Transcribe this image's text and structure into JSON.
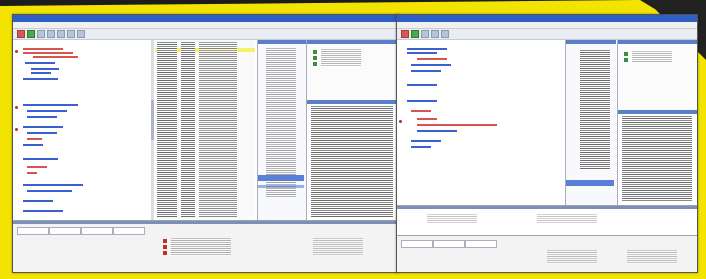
{
  "screens": [
    {
      "name": "left-debugger-window",
      "app": "debugger",
      "title_text": "",
      "menu_text": ""
    },
    {
      "name": "right-debugger-window",
      "app": "debugger",
      "title_text": "",
      "menu_text": ""
    }
  ],
  "colors": {
    "frame_yellow": "#f2e400",
    "title_blue": "#2d5fc4",
    "code_red": "#d9534f",
    "code_blue": "#3a5fcf",
    "selection_blue": "#5a7fd6",
    "breakpoint": "#c42b2b"
  },
  "icons": [
    "breakpoint-icon",
    "toolbar-button-icon",
    "run-icon",
    "stop-icon"
  ]
}
